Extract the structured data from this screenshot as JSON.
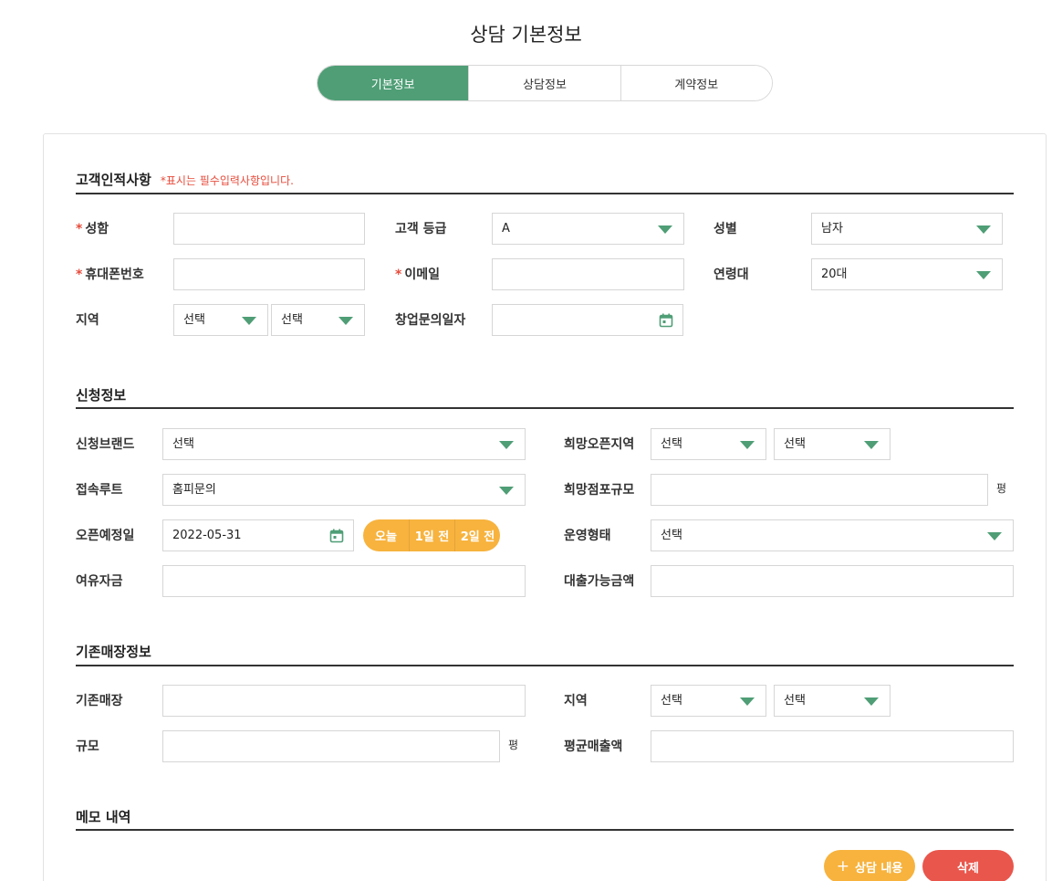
{
  "page_title": "상담 기본정보",
  "tabs": [
    {
      "label": "기본정보",
      "active": true
    },
    {
      "label": "상담정보",
      "active": false
    },
    {
      "label": "계약정보",
      "active": false
    }
  ],
  "customer": {
    "title": "고객인적사항",
    "note": "*표시는 필수입력사항입니다.",
    "required_mark": "*",
    "name_label": "성함",
    "name_value": "",
    "grade_label": "고객 등급",
    "grade_value": "A",
    "gender_label": "성별",
    "gender_value": "남자",
    "phone_label": "휴대폰번호",
    "phone_value": "",
    "email_label": "이메일",
    "email_value": "",
    "age_label": "연령대",
    "age_value": "20대",
    "region_label": "지역",
    "region_value_1": "선택",
    "region_value_2": "선택",
    "inquiry_date_label": "창업문의일자",
    "inquiry_date_value": ""
  },
  "application": {
    "title": "신청정보",
    "brand_label": "신청브랜드",
    "brand_value": "선택",
    "open_region_label": "희망오픈지역",
    "open_region_value_1": "선택",
    "open_region_value_2": "선택",
    "route_label": "접속루트",
    "route_value": "홈피문의",
    "store_size_label": "희망점포규모",
    "store_size_value": "",
    "unit_pyeong": "평",
    "open_date_label": "오픈예정일",
    "open_date_value": "2022-05-31",
    "date_buttons": [
      "오늘",
      "1일 전",
      "2일 전"
    ],
    "operation_label": "운영형태",
    "operation_value": "선택",
    "funds_label": "여유자금",
    "funds_value": "",
    "loan_label": "대출가능금액",
    "loan_value": ""
  },
  "existing": {
    "title": "기존매장정보",
    "store_label": "기존매장",
    "store_value": "",
    "region_label": "지역",
    "region_value_1": "선택",
    "region_value_2": "선택",
    "size_label": "규모",
    "size_value": "",
    "unit_pyeong": "평",
    "sales_label": "평균매출액",
    "sales_value": ""
  },
  "memo": {
    "title": "메모 내역"
  },
  "actions": {
    "add_consult_icon": "plus-icon",
    "add_consult_label": "상담 내용",
    "delete_label": "삭제"
  },
  "colors": {
    "accent_green": "#4f9e76",
    "accent_yellow": "#f7b33e",
    "danger_red": "#e9564c",
    "required_red": "#e74c3c"
  }
}
